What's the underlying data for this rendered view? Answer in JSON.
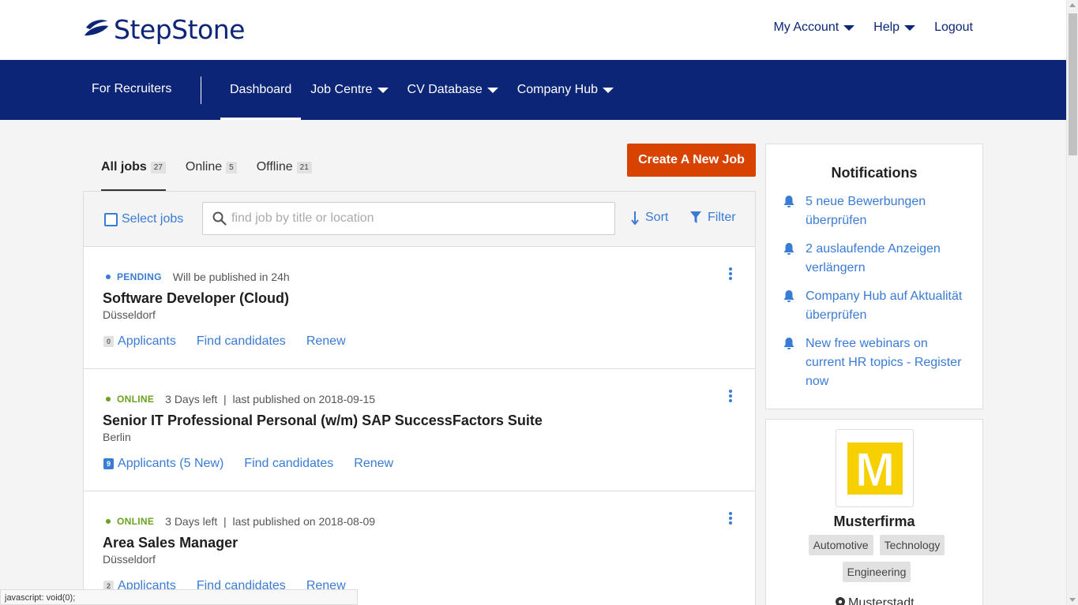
{
  "brand": {
    "name": "StepStone",
    "color": "#0c2577",
    "accent": "#d94300",
    "link": "#3a7bd5"
  },
  "topnav": {
    "account": "My Account",
    "help": "Help",
    "logout": "Logout"
  },
  "mainnav": {
    "recruiters": "For Recruiters",
    "dashboard": "Dashboard",
    "job_centre": "Job Centre",
    "cv_database": "CV Database",
    "company_hub": "Company Hub"
  },
  "tabs": [
    {
      "label": "All jobs",
      "count": "27"
    },
    {
      "label": "Online",
      "count": "5"
    },
    {
      "label": "Offline",
      "count": "21"
    }
  ],
  "create_button": "Create A New Job",
  "toolbar": {
    "select_jobs": "Select jobs",
    "search_placeholder": "find job by title or location",
    "sort": "Sort",
    "filter": "Filter"
  },
  "jobs": [
    {
      "status": "PENDING",
      "status_color": "#3a7bd5",
      "info": "Will be published in 24h",
      "title": "Software Developer (Cloud)",
      "city": "Düsseldorf",
      "applicants_count": "0",
      "applicants_label": "Applicants",
      "find": "Find candidates",
      "renew": "Renew"
    },
    {
      "status": "ONLINE",
      "status_color": "#6aa120",
      "info": "3 Days left  |  last published on 2018-09-15",
      "title": "Senior IT Professional Personal (w/m) SAP SuccessFactors Suite",
      "city": "Berlin",
      "applicants_count": "9",
      "applicants_label": "Applicants (5 New)",
      "find": "Find candidates",
      "renew": "Renew"
    },
    {
      "status": "ONLINE",
      "status_color": "#6aa120",
      "info": "3 Days left  |  last published on 2018-08-09",
      "title": "Area Sales Manager",
      "city": "Düsseldorf",
      "applicants_count": "2",
      "applicants_label": "Applicants",
      "find": "Find candidates",
      "renew": "Renew"
    }
  ],
  "notifications": {
    "title": "Notifications",
    "items": [
      "5 neue Bewerbungen überprüfen",
      "2 auslaufende Anzeigen verlängern",
      "Company Hub auf Aktualität überprüfen",
      "New free webinars on current HR topics - Register now"
    ]
  },
  "company": {
    "logo_letter": "M",
    "name": "Musterfirma",
    "tags": [
      "Automotive",
      "Technology",
      "Engineering"
    ],
    "location": "Musterstadt"
  },
  "statusbar": "javascript: void(0);"
}
